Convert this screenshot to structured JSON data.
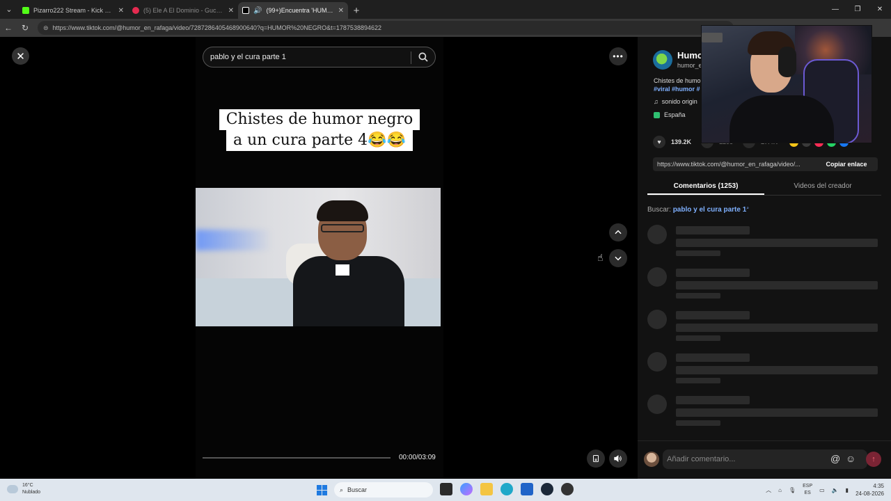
{
  "browser": {
    "tabs": [
      {
        "title": "Pizarro222 Stream - Kick Dashboard",
        "active": false,
        "favicon_color": "#53fc18"
      },
      {
        "title": "(5) Ele A El Dominio - Gucci En Mi...",
        "active": false,
        "favicon_color": "#e52b50"
      },
      {
        "title": "(99+)Encuentra 'HUMOR NEGRO'",
        "active": true,
        "favicon_color": "#ffffff"
      }
    ],
    "url": "https://www.tiktok.com/@humor_en_rafaga/video/7287286405468900640?q=HUMOR%20NEGRO&t=1787538894622"
  },
  "video": {
    "search_query": "pablo y el cura parte 1",
    "caption_line1": "Chistes de humor negro",
    "caption_line2": "a un cura parte 4😂😂",
    "time": "00:00/03:09",
    "progress_fraction": 0.0
  },
  "panel": {
    "author_name": "Humo",
    "author_handle": "humor_e",
    "description": "Chistes de humo",
    "tags": "#viral #humor #",
    "sound": "sonido origin",
    "region": "España",
    "likes": "139.2K",
    "comments_count": "1253",
    "shares_count": "27.4K",
    "link": "https://www.tiktok.com/@humor_en_rafaga/video/...",
    "copy_label": "Copiar enlace",
    "tab_comments": "Comentarios (1253)",
    "tab_creator": "Videos del creador",
    "search_label": "Buscar:",
    "search_term": "pablo y el cura parte 1",
    "comment_placeholder": "Añadir comentario...",
    "share_colors": [
      "#f5c518",
      "#3a3a3a",
      "#fe2c55",
      "#25d366",
      "#1877f2"
    ]
  },
  "taskbar": {
    "temperature": "16°C",
    "condition": "Nublado",
    "search_placeholder": "Buscar",
    "lang_top": "ESP",
    "lang_bottom": "ES",
    "time": "4:35",
    "date": "24-08-2026"
  }
}
